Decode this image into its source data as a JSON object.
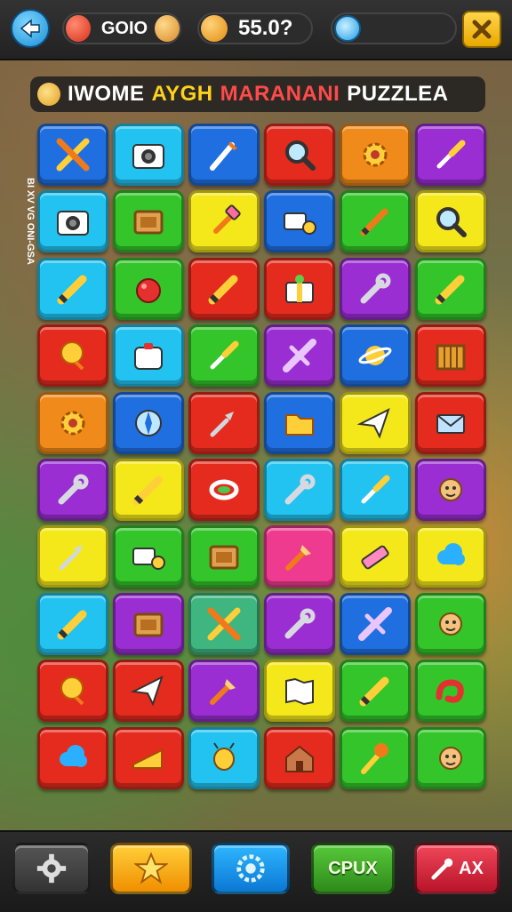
{
  "colors": {
    "blue": "#1f6fe0",
    "cyan": "#22c3f0",
    "red": "#e52b1e",
    "orange": "#f08a1a",
    "purple": "#9a2ed2",
    "green": "#33c52a",
    "yellow": "#f5e81a",
    "teal": "#3fb580",
    "pink": "#ee3a8f"
  },
  "topbar": {
    "back_icon": "back-arrow-icon",
    "coins_value": "GOIO",
    "score_value": "55.0?",
    "energy_icon": "energy-orb-icon",
    "close_icon": "close-x-icon"
  },
  "title": {
    "part1": "IWOME",
    "part2": "AYGH",
    "part3": "MARANANI",
    "part4": "PUZZLEA"
  },
  "side_text": "BI XV VG ONI-GSA",
  "grid": {
    "rows": [
      [
        {
          "color": "blue",
          "icon": "crossed-tools-icon"
        },
        {
          "color": "cyan",
          "icon": "camera-icon"
        },
        {
          "color": "blue",
          "icon": "paintbrush-icon"
        },
        {
          "color": "red",
          "icon": "magnifier-icon"
        },
        {
          "color": "orange",
          "icon": "gear-icon"
        },
        {
          "color": "purple",
          "icon": "screwdriver-icon"
        }
      ],
      [
        {
          "color": "cyan",
          "icon": "camera-icon"
        },
        {
          "color": "green",
          "icon": "box-icon"
        },
        {
          "color": "yellow",
          "icon": "hammer-icon"
        },
        {
          "color": "blue",
          "icon": "tape-measure-icon"
        },
        {
          "color": "green",
          "icon": "pencil-icon"
        },
        {
          "color": "yellow",
          "icon": "magnifier-icon"
        }
      ],
      [
        {
          "color": "cyan",
          "icon": "crayon-icon"
        },
        {
          "color": "green",
          "icon": "ball-icon"
        },
        {
          "color": "red",
          "icon": "crayon-icon"
        },
        {
          "color": "red",
          "icon": "gift-box-icon"
        },
        {
          "color": "purple",
          "icon": "wrench-icon"
        },
        {
          "color": "green",
          "icon": "crayon-icon"
        }
      ],
      [
        {
          "color": "red",
          "icon": "balloon-icon"
        },
        {
          "color": "cyan",
          "icon": "lunchbox-icon"
        },
        {
          "color": "green",
          "icon": "screwdriver-icon"
        },
        {
          "color": "purple",
          "icon": "airplane-icon"
        },
        {
          "color": "blue",
          "icon": "planet-icon"
        },
        {
          "color": "red",
          "icon": "crate-icon"
        }
      ],
      [
        {
          "color": "orange",
          "icon": "gear-icon"
        },
        {
          "color": "blue",
          "icon": "compass-icon"
        },
        {
          "color": "red",
          "icon": "pin-icon"
        },
        {
          "color": "blue",
          "icon": "folder-icon"
        },
        {
          "color": "yellow",
          "icon": "paper-plane-icon"
        },
        {
          "color": "red",
          "icon": "envelope-icon"
        }
      ],
      [
        {
          "color": "purple",
          "icon": "wrench-icon"
        },
        {
          "color": "yellow",
          "icon": "crayon-icon"
        },
        {
          "color": "red",
          "icon": "ring-icon"
        },
        {
          "color": "cyan",
          "icon": "wrench-icon"
        },
        {
          "color": "cyan",
          "icon": "screwdriver-icon"
        },
        {
          "color": "purple",
          "icon": "face-icon"
        }
      ],
      [
        {
          "color": "yellow",
          "icon": "pin-icon"
        },
        {
          "color": "green",
          "icon": "tape-measure-icon"
        },
        {
          "color": "green",
          "icon": "box-icon"
        },
        {
          "color": "pink",
          "icon": "brush-icon"
        },
        {
          "color": "yellow",
          "icon": "eraser-icon"
        },
        {
          "color": "yellow",
          "icon": "cloud-icon"
        }
      ],
      [
        {
          "color": "cyan",
          "icon": "crayon-icon"
        },
        {
          "color": "purple",
          "icon": "box-icon"
        },
        {
          "color": "teal",
          "icon": "crossed-tools-icon"
        },
        {
          "color": "purple",
          "icon": "wrench-icon"
        },
        {
          "color": "blue",
          "icon": "airplane-icon"
        },
        {
          "color": "green",
          "icon": "face-icon"
        }
      ],
      [
        {
          "color": "red",
          "icon": "balloon-icon"
        },
        {
          "color": "red",
          "icon": "paper-plane-icon"
        },
        {
          "color": "purple",
          "icon": "brush-icon"
        },
        {
          "color": "yellow",
          "icon": "map-icon"
        },
        {
          "color": "green",
          "icon": "crayon-icon"
        },
        {
          "color": "green",
          "icon": "snake-icon"
        }
      ],
      [
        {
          "color": "red",
          "icon": "cloud-icon"
        },
        {
          "color": "red",
          "icon": "cheese-icon"
        },
        {
          "color": "cyan",
          "icon": "bug-icon"
        },
        {
          "color": "red",
          "icon": "house-icon"
        },
        {
          "color": "green",
          "icon": "torch-icon"
        },
        {
          "color": "green",
          "icon": "face-icon"
        }
      ]
    ]
  },
  "bottombar": {
    "settings_icon": "gear-icon",
    "star_icon": "star-icon",
    "target_icon": "target-gear-icon",
    "cpux_label": "CPUX",
    "ax_label": "AX",
    "ax_icon": "tools-icon"
  }
}
